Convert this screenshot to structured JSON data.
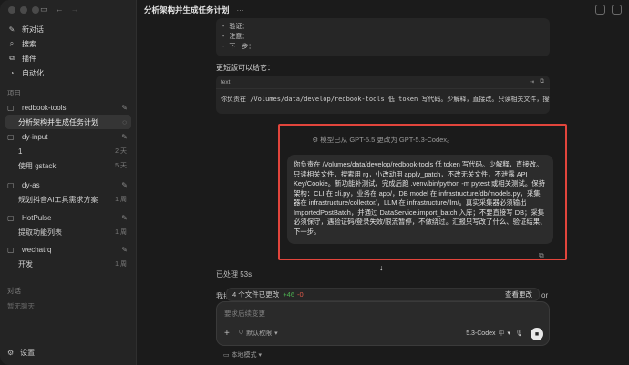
{
  "sidebar": {
    "nav": [
      {
        "icon": "compose-icon",
        "glyph": "✎",
        "label": "新对话"
      },
      {
        "icon": "search-icon",
        "glyph": "⌕",
        "label": "搜索"
      },
      {
        "icon": "plugin-icon",
        "glyph": "⧉",
        "label": "插件"
      },
      {
        "icon": "automation-icon",
        "glyph": "◔",
        "label": "自动化"
      }
    ],
    "projects_label": "项目",
    "groups": [
      {
        "name": "redbook-tools",
        "threads": [
          {
            "title": "分析架构并生成任务计划",
            "age": "",
            "running": true,
            "selected": true
          }
        ]
      },
      {
        "name": "dy-input",
        "threads": [
          {
            "title": "1",
            "age": "2 天"
          },
          {
            "title": "使用 gstack",
            "age": "5 天"
          }
        ]
      },
      {
        "name": "dy-as",
        "threads": [
          {
            "title": "规划抖音AI工具需求方案",
            "age": "1 周"
          }
        ]
      },
      {
        "name": "HotPulse",
        "threads": [
          {
            "title": "提取功能列表",
            "age": "1 周"
          }
        ]
      },
      {
        "name": "wechatrq",
        "threads": [
          {
            "title": "开发",
            "age": "1 周"
          }
        ]
      }
    ],
    "chats_label": "对话",
    "no_chats": "暂无聊天",
    "settings_label": "设置"
  },
  "topbar": {
    "title": "分析架构并生成任务计划",
    "more": "···"
  },
  "code1": {
    "lines": [
      "- 验证：",
      "- 注意：",
      "- 下一步："
    ]
  },
  "shorter_label": "更短版可以给它：",
  "code2": {
    "lang": "text",
    "body": "你负责在 /Volumes/data/develop/redbook-tools 低 token 写代码。少解释，直接改。只读相关文件，搜索"
  },
  "model_note": "模型已从 GPT-5.5 更改为 GPT-5.3-Codex。",
  "bubble_text": "你负责在 /Volumes/data/develop/redbook-tools 低 token 写代码。少解释，直接改。只读相关文件，搜索用 rg，小改动用 apply_patch，不改无关文件，不泄露 API Key/Cookie。新功能补测试，完成后跑 .venv/bin/python -m pytest 或相关测试。保持架构：CLI 在 cli.py，业务在 app/，DB model 在 infrastructure/db/models.py，采集器在 infrastructure/collector/，LLM 在 infrastructure/llm/。真实采集器必须输出 ImportedPostBatch，并通过 DataService.import_batch 入库；不要直接写 DB；采集必须保守，遇验证码/登录失效/限流暂停，不做绕过。汇报只写改了什么、验证结果、下一步。",
  "processed": "已处理 53s",
  "partial_left": "我把",
  "partial_right": "or",
  "files": {
    "summary": "4 个文件已更改",
    "plus": "+46",
    "minus": "-0",
    "review": "查看更改"
  },
  "composer": {
    "placeholder": "要求后续变更",
    "permission": "默认权限",
    "model": "5.3-Codex",
    "effort": "中"
  },
  "local_mode": "本地模式",
  "colors": {
    "accent_red": "#e2453c",
    "plus": "#4caf50",
    "minus": "#e05a4a"
  }
}
